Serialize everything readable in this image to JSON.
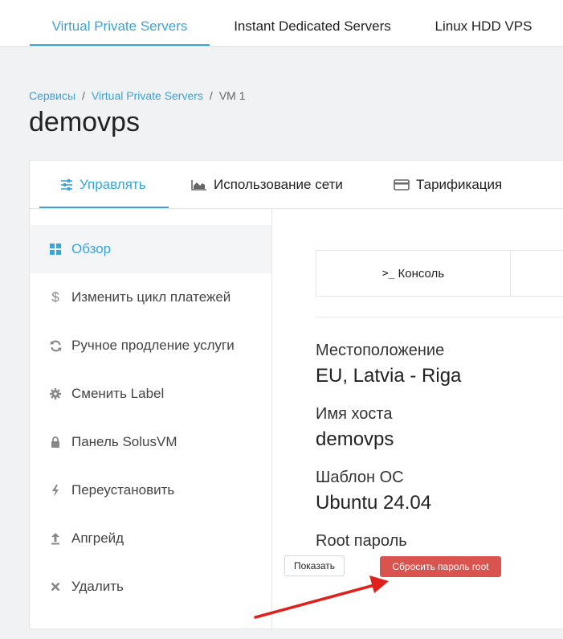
{
  "topnav": {
    "tabs": [
      {
        "label": "Virtual Private Servers"
      },
      {
        "label": "Instant Dedicated Servers"
      },
      {
        "label": "Linux HDD VPS"
      }
    ]
  },
  "breadcrumb": {
    "items": [
      "Сервисы",
      "Virtual Private Servers",
      "VM 1"
    ]
  },
  "page_title": "demovps",
  "card_tabs": [
    {
      "label": "Управлять",
      "icon": "sliders-icon"
    },
    {
      "label": "Использование сети",
      "icon": "area-chart-icon"
    },
    {
      "label": "Тарификация",
      "icon": "credit-card-icon"
    }
  ],
  "sidebar": {
    "items": [
      {
        "label": "Обзор",
        "icon": "grid-icon"
      },
      {
        "label": "Изменить цикл платежей",
        "icon": "dollar-icon"
      },
      {
        "label": "Ручное продление услуги",
        "icon": "refresh-icon"
      },
      {
        "label": "Сменить Label",
        "icon": "gear-icon"
      },
      {
        "label": "Панель SolusVM",
        "icon": "lock-icon"
      },
      {
        "label": "Переустановить",
        "icon": "bolt-icon"
      },
      {
        "label": "Апгрейд",
        "icon": "upload-icon"
      },
      {
        "label": "Удалить",
        "icon": "close-icon"
      }
    ]
  },
  "content": {
    "console_label": "Консоль",
    "console_prompt": ">_",
    "location_label": "Местоположение",
    "location_value": "EU, Latvia - Riga",
    "hostname_label": "Имя хоста",
    "hostname_value": "demovps",
    "os_label": "Шаблон ОС",
    "os_value": "Ubuntu 24.04",
    "root_label": "Root пароль",
    "show_button": "Показать",
    "reset_button": "Сбросить пароль root"
  },
  "colors": {
    "accent": "#3aa3d9",
    "danger": "#d9534f",
    "annotation_arrow": "#e0201b"
  }
}
